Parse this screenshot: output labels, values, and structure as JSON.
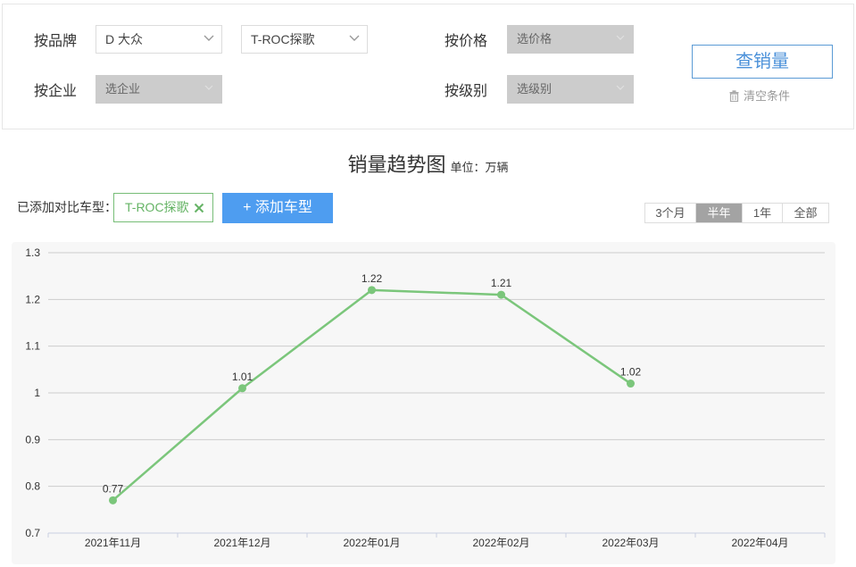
{
  "filters": {
    "brand_label": "按品牌",
    "brand_value": "D 大众",
    "model_value": "T-ROC探歌",
    "price_label": "按价格",
    "price_placeholder": "选价格",
    "company_label": "按企业",
    "company_placeholder": "选企业",
    "level_label": "按级别",
    "level_placeholder": "选级别",
    "query_button": "查销量",
    "clear_link": "清空条件"
  },
  "colors": {
    "line": "#7bc67b",
    "accent_blue": "#4e9df0",
    "query_border": "#5b9bd5",
    "disabled_select": "#cccccc"
  },
  "compare": {
    "label": "已添加对比车型：",
    "tags": [
      "T-ROC探歌"
    ],
    "add_button": "+ 添加车型"
  },
  "range_tabs": [
    {
      "label": "3个月",
      "active": false
    },
    {
      "label": "半年",
      "active": true
    },
    {
      "label": "1年",
      "active": false
    },
    {
      "label": "全部",
      "active": false
    }
  ],
  "chart_data": {
    "type": "line",
    "title": "销量趋势图",
    "subtitle": "单位：万辆",
    "categories": [
      "2021年11月",
      "2021年12月",
      "2022年01月",
      "2022年02月",
      "2022年03月",
      "2022年04月"
    ],
    "series": [
      {
        "values": [
          0.77,
          1.01,
          1.22,
          1.21,
          1.02,
          null
        ]
      }
    ],
    "yticks": [
      "0.7",
      "0.8",
      "0.9",
      "1",
      "1.1",
      "1.2",
      "1.3"
    ],
    "ylim": [
      0.7,
      1.3
    ],
    "grid": true,
    "legend": "none"
  }
}
